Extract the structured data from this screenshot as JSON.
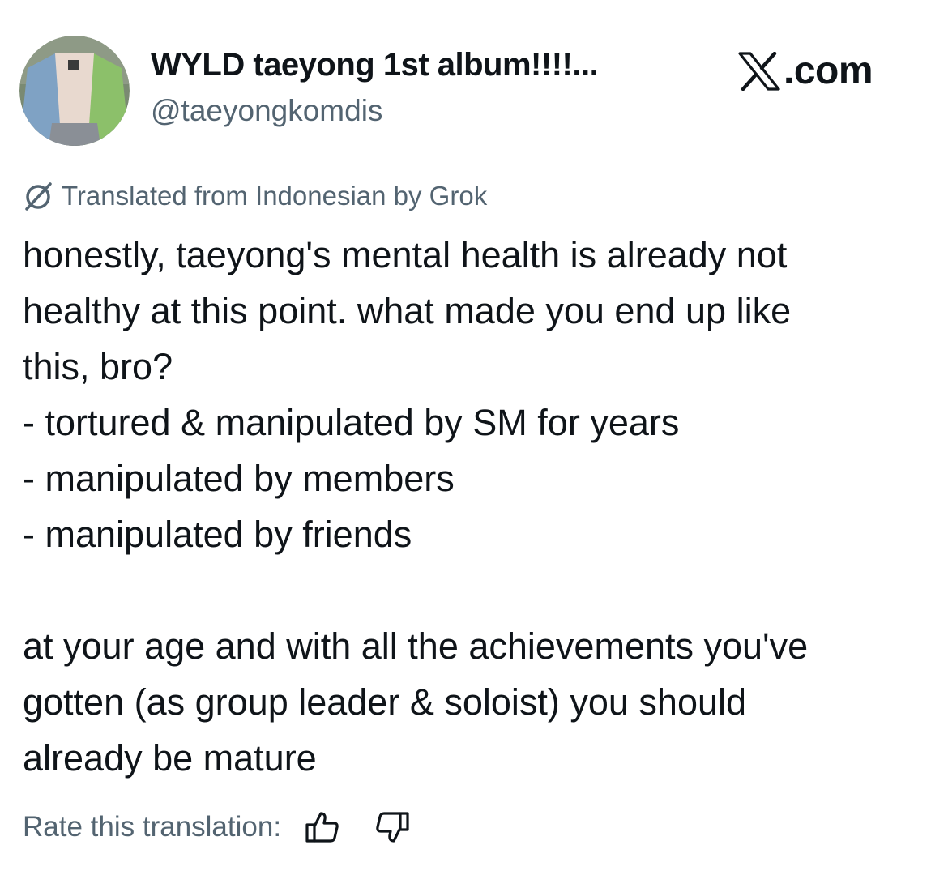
{
  "author": {
    "display_name": "WYLD taeyong 1st album!!!!...",
    "handle": "@taeyongkomdis",
    "avatar_icon": "profile-photo-avatar"
  },
  "brand": {
    "logo_icon": "x-logo-icon",
    "text": ".com"
  },
  "translation": {
    "icon": "translate-icon",
    "notice": "Translated from Indonesian by Grok"
  },
  "tweet": {
    "lines": [
      "honestly, taeyong's mental health is already not",
      "healthy at this point. what made you end up like",
      "this, bro?",
      "- tortured & manipulated by SM for years",
      "- manipulated by members",
      "- manipulated by friends",
      "",
      "at your age and with all the achievements you've",
      "gotten (as group leader & soloist) you should",
      "already be mature"
    ]
  },
  "rating": {
    "label": "Rate this translation:",
    "thumbs_up_icon": "thumbs-up-icon",
    "thumbs_down_icon": "thumbs-down-icon"
  },
  "colors": {
    "text_primary": "#0f1419",
    "text_secondary": "#536471",
    "background": "#ffffff"
  }
}
